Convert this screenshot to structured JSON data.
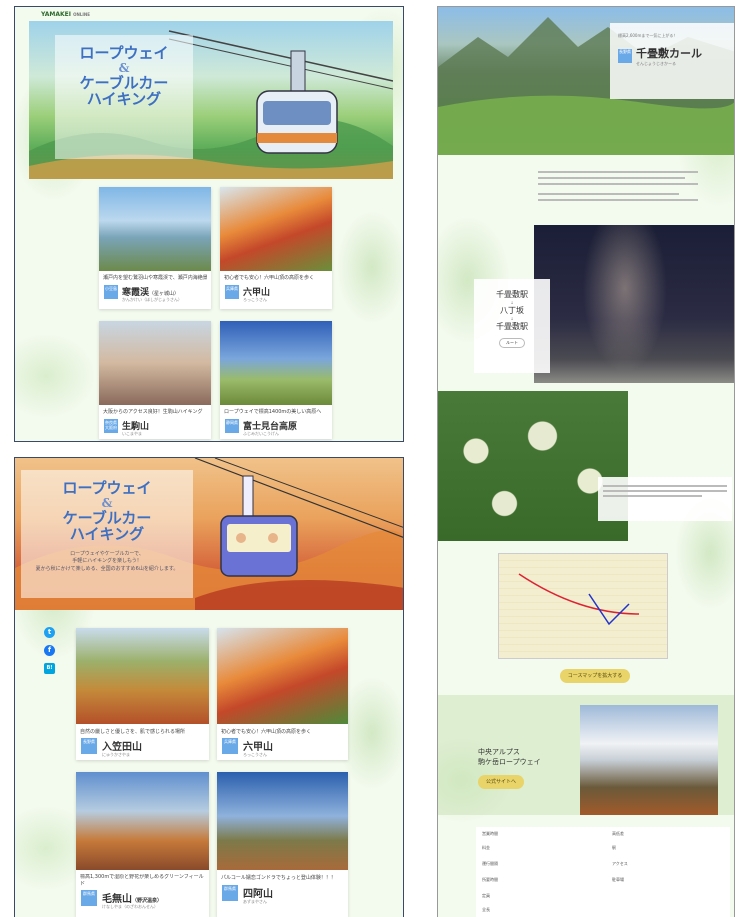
{
  "panel1": {
    "logo": "YAMAKEI",
    "logo_sub": "ONLINE",
    "title_line1": "ロープウェイ",
    "title_amp": "&",
    "title_line2": "ケーブルカー",
    "title_line3": "ハイキング",
    "cards": [
      {
        "caption": "瀬戸内を望む鷲羽山や寒霞渓で、瀬戸内海絶景の醍醐味を味わう",
        "tag": "小豆島",
        "name": "寒霞渓",
        "name_suffix": "（星ヶ城山）",
        "kana": "かんかけい（ほしがじょうさん）"
      },
      {
        "caption": "初心者でも安心！六甲山頂の高原を歩く",
        "tag": "兵庫県",
        "name": "六甲山",
        "name_suffix": "",
        "kana": "ろっこうさん"
      },
      {
        "caption": "大阪からのアクセス良好！生駒山ハイキング",
        "tag": "奈良県 大阪府",
        "name": "生駒山",
        "name_suffix": "",
        "kana": "いこまやま"
      },
      {
        "caption": "ロープウェイで標高1400mの美しい高原へ",
        "tag": "静岡県",
        "name": "富士見台高原",
        "name_suffix": "",
        "kana": "ふじみだいこうげん"
      }
    ]
  },
  "panel2": {
    "title_line1": "ロープウェイ",
    "title_amp": "&",
    "title_line2": "ケーブルカー",
    "title_line3": "ハイキング",
    "subtitle1": "ロープウェイやケーブルカーで、",
    "subtitle2": "手軽にハイキングを楽しもう！",
    "subtitle3": "夏から秋にかけて楽しめる、全国のおすすめ6山を紹介します。",
    "social": {
      "twitter": "t",
      "facebook": "f",
      "hatena": "B!"
    },
    "cards": [
      {
        "caption": "自然の厳しさと優しさを、肌で感じられる場所",
        "tag": "長野県",
        "name": "入笠田山",
        "kana": "にゅうかさやま"
      },
      {
        "caption": "初心者でも安心！六甲山頂の高原を歩く",
        "tag": "兵庫県",
        "name": "六甲山",
        "kana": "ろっこうさん"
      },
      {
        "caption": "標高1,300mで湿原と野花が楽しめるグリーンフィールド",
        "tag": "群馬県",
        "name": "毛無山",
        "name_suffix": "（野沢温泉）",
        "kana": "けなしやま（のざわおんせん）"
      },
      {
        "caption": "パルコール嬬恋ゴンドラでちょっと登山体験！！！",
        "tag": "群馬県",
        "name": "四阿山",
        "kana": "あずまやさん"
      }
    ]
  },
  "panel3": {
    "hero_kicker": "標高2,600mまで一気に上がる！",
    "hero_tag": "長野県",
    "hero_title": "千畳敷カール",
    "hero_kana": "せんじょうじきかーる",
    "route1": "千畳敷駅",
    "route2": "八丁坂",
    "route3": "千畳敷駅",
    "route_btn": "ルート",
    "map_button": "コースマップを拡大する",
    "ropeway_title1": "中央アルプス",
    "ropeway_title2": "駒ケ岳ロープウェイ",
    "ropeway_button": "公式サイトへ",
    "table_left": [
      "営業時間",
      "料金",
      "運行間隔",
      "所要時間",
      "定員",
      "全長"
    ],
    "table_right": [
      "高低差",
      "駅",
      "アクセス",
      "駐車場"
    ]
  },
  "colors": {
    "accent_blue": "#3d6fc2",
    "tag_blue": "#6aa9e8",
    "button_yellow": "#e8d468"
  }
}
